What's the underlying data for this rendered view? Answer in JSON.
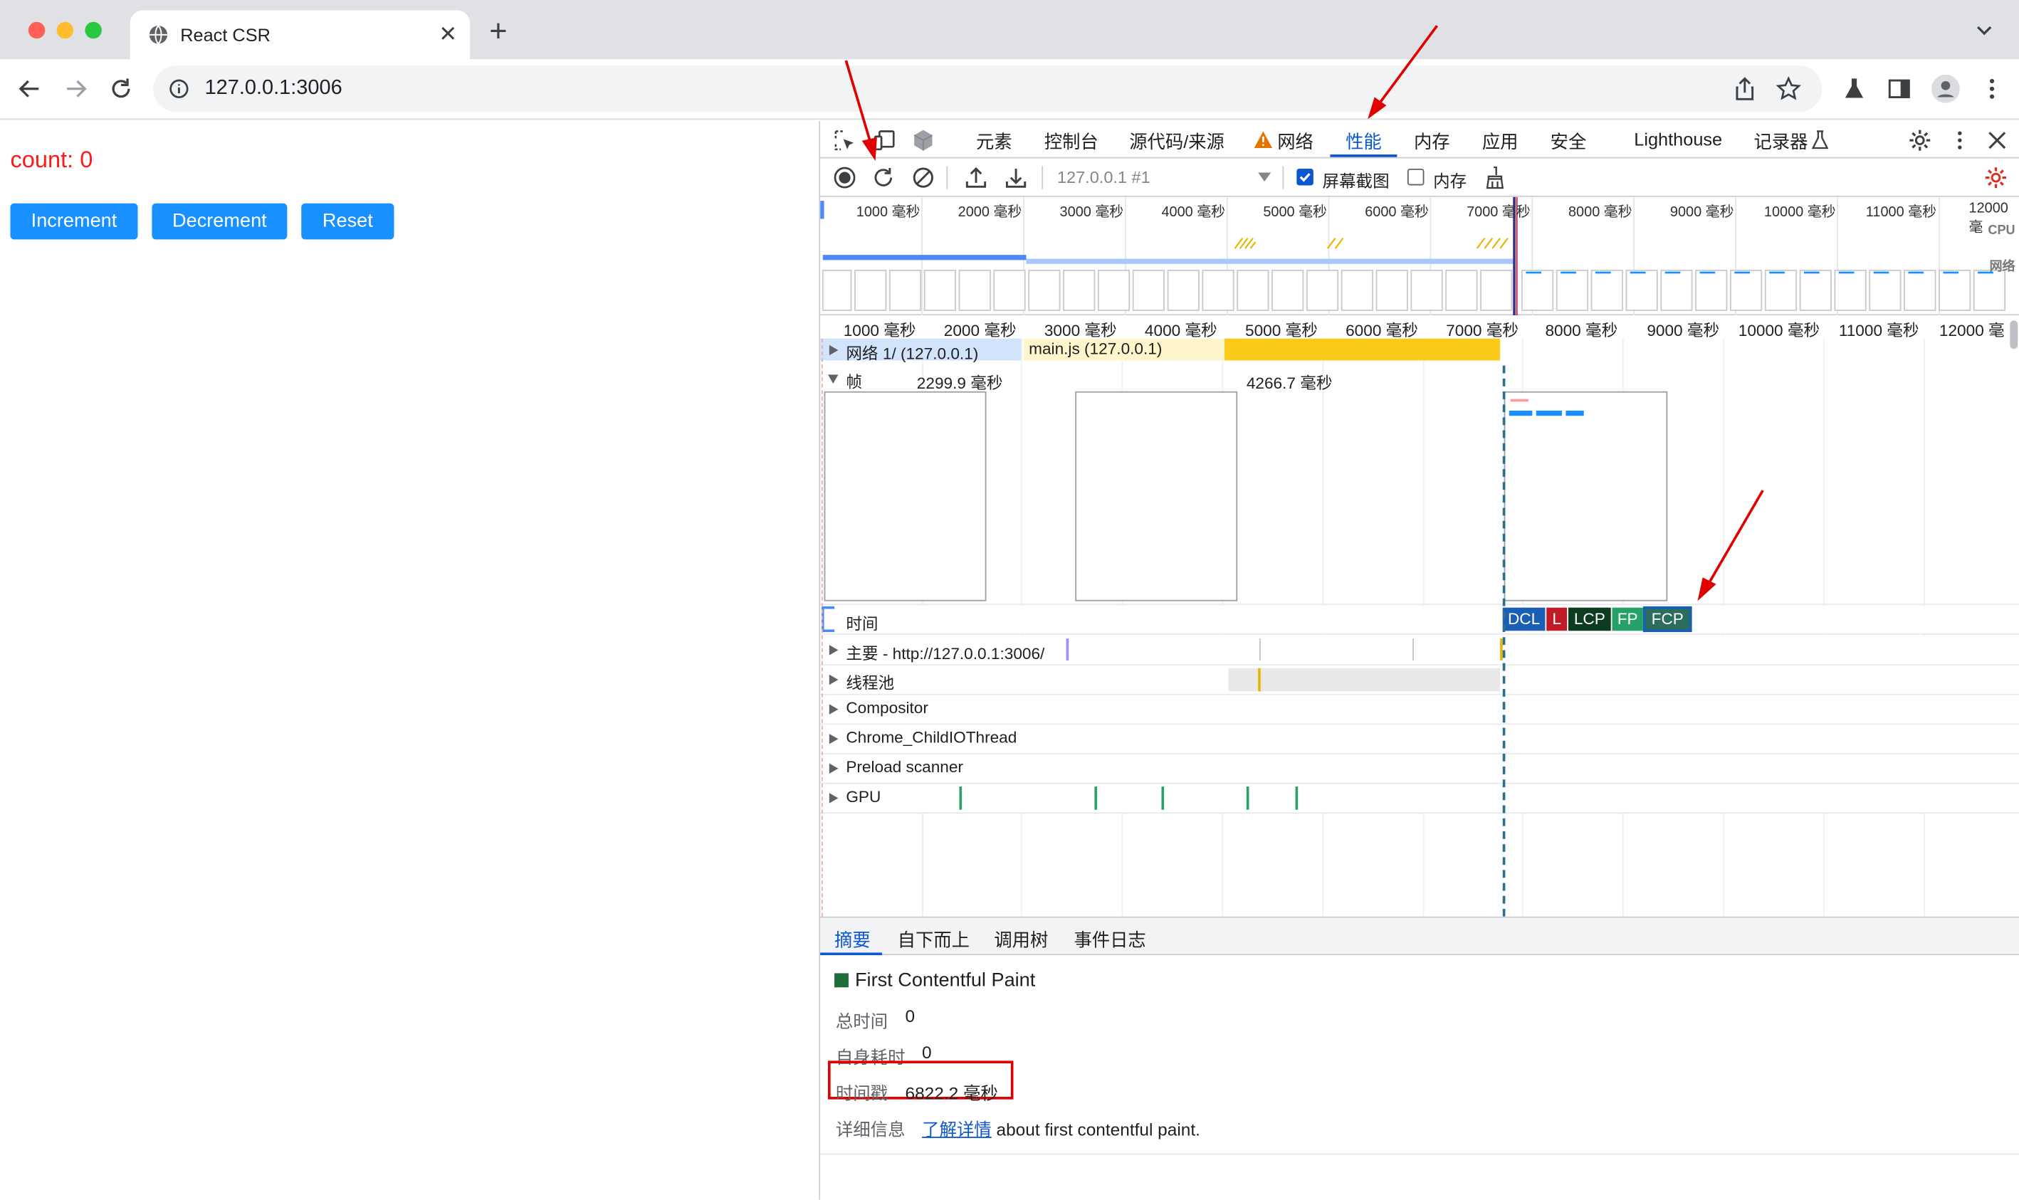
{
  "browser": {
    "tab_title": "React CSR",
    "url": "127.0.0.1:3006"
  },
  "page": {
    "count_text": "count: 0",
    "buttons": [
      "Increment",
      "Decrement",
      "Reset"
    ],
    "accent_color": "#1890ff",
    "count_color": "#ff1a1a"
  },
  "devtools": {
    "tabs": [
      "元素",
      "控制台",
      "源代码/来源",
      "网络",
      "性能",
      "内存",
      "应用",
      "安全",
      "Lighthouse",
      "记录器"
    ],
    "active_tab": "性能",
    "recording_select": "127.0.0.1 #1",
    "screenshots_label": "屏幕截图",
    "screenshots_checked": true,
    "memory_label": "内存",
    "memory_checked": false,
    "overview_ticks": [
      "1000 毫秒",
      "2000 毫秒",
      "3000 毫秒",
      "4000 毫秒",
      "5000 毫秒",
      "6000 毫秒",
      "7000 毫秒",
      "8000 毫秒",
      "9000 毫秒",
      "10000 毫秒",
      "11000 毫秒",
      "12000 毫"
    ],
    "overview_cpu_label": "CPU",
    "overview_net_label": "网络",
    "ruler_ticks": [
      "1000 毫秒",
      "2000 毫秒",
      "3000 毫秒",
      "4000 毫秒",
      "5000 毫秒",
      "6000 毫秒",
      "7000 毫秒",
      "8000 毫秒",
      "9000 毫秒",
      "10000 毫秒",
      "11000 毫秒",
      "12000 毫"
    ],
    "network_track": {
      "label": "网络 1/ (127.0.0.1)",
      "main_js": "main.js (127.0.0.1)"
    },
    "frames_track": {
      "label": "帧",
      "frame1_time": "2299.9 毫秒",
      "frame2_time": "4266.7 毫秒"
    },
    "timings_label": "时间",
    "markers": [
      {
        "label": "DCL",
        "color": "#1a5fb4"
      },
      {
        "label": "L",
        "color": "#c01c28"
      },
      {
        "label": "LCP",
        "color": "#0d3b20"
      },
      {
        "label": "FP",
        "color": "#26a269"
      },
      {
        "label": "FCP",
        "color": "#2b6e5e"
      }
    ],
    "tracks": [
      "主要 - http://127.0.0.1:3006/",
      "线程池",
      "Compositor",
      "Chrome_ChildIOThread",
      "Preload scanner",
      "GPU"
    ],
    "bottom_tabs": [
      "摘要",
      "自下而上",
      "调用树",
      "事件日志"
    ],
    "active_bottom_tab": "摘要",
    "summary": {
      "title": "First Contentful Paint",
      "total_time_label": "总时间",
      "total_time": "0",
      "self_time_label": "自身耗时",
      "self_time": "0",
      "timestamp_label": "时间戳",
      "timestamp": "6822.2 毫秒",
      "details_label": "详细信息",
      "learn_more": "了解详情",
      "details_suffix": "about first contentful paint."
    }
  }
}
